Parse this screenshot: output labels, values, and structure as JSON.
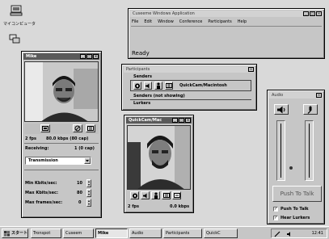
{
  "desktop": {
    "computer_label": "マイコンピュータ"
  },
  "main_window": {
    "title": "Cuseeme Windows Application",
    "menu": [
      "File",
      "Edit",
      "Window",
      "Conference",
      "Participants",
      "Help"
    ],
    "status": "Ready"
  },
  "video_window_1": {
    "title": "Mike",
    "fps": "2 fps",
    "kbps": "80.0 kbps (80 cap)",
    "receiving_label": "Receiving:",
    "receiving_value": "1 (0 cap)",
    "dropdown_value": "Transmission",
    "settings": [
      {
        "label": "Min Kbits/sec:",
        "value": "10"
      },
      {
        "label": "Max Kbits/sec:",
        "value": "80"
      },
      {
        "label": "Max frames/sec:",
        "value": "0"
      }
    ]
  },
  "participants": {
    "title": "Participants",
    "senders_header": "Senders",
    "sender_name": "QuickCam/Macintosh",
    "senders_not_showing": "Senders (not showing)",
    "lurkers": "Lurkers"
  },
  "video_window_2": {
    "title": "QuickCam/Mac",
    "fps": "2 fps",
    "kbps": "0.0 kbps"
  },
  "audio": {
    "title": "Audio",
    "push_to_talk_button": "Push To Talk",
    "checkbox_push_to_talk": "Push To Talk",
    "checkbox_hear_lurkers": "Hear Lurkers",
    "push_to_talk_checked": true,
    "hear_lurkers_checked": true
  },
  "taskbar": {
    "start_label": "スタート",
    "buttons": [
      "Tronspot",
      "Cuseem",
      "Mike",
      "Audio",
      "Participants",
      "QuickC"
    ],
    "clock": "12:41"
  }
}
